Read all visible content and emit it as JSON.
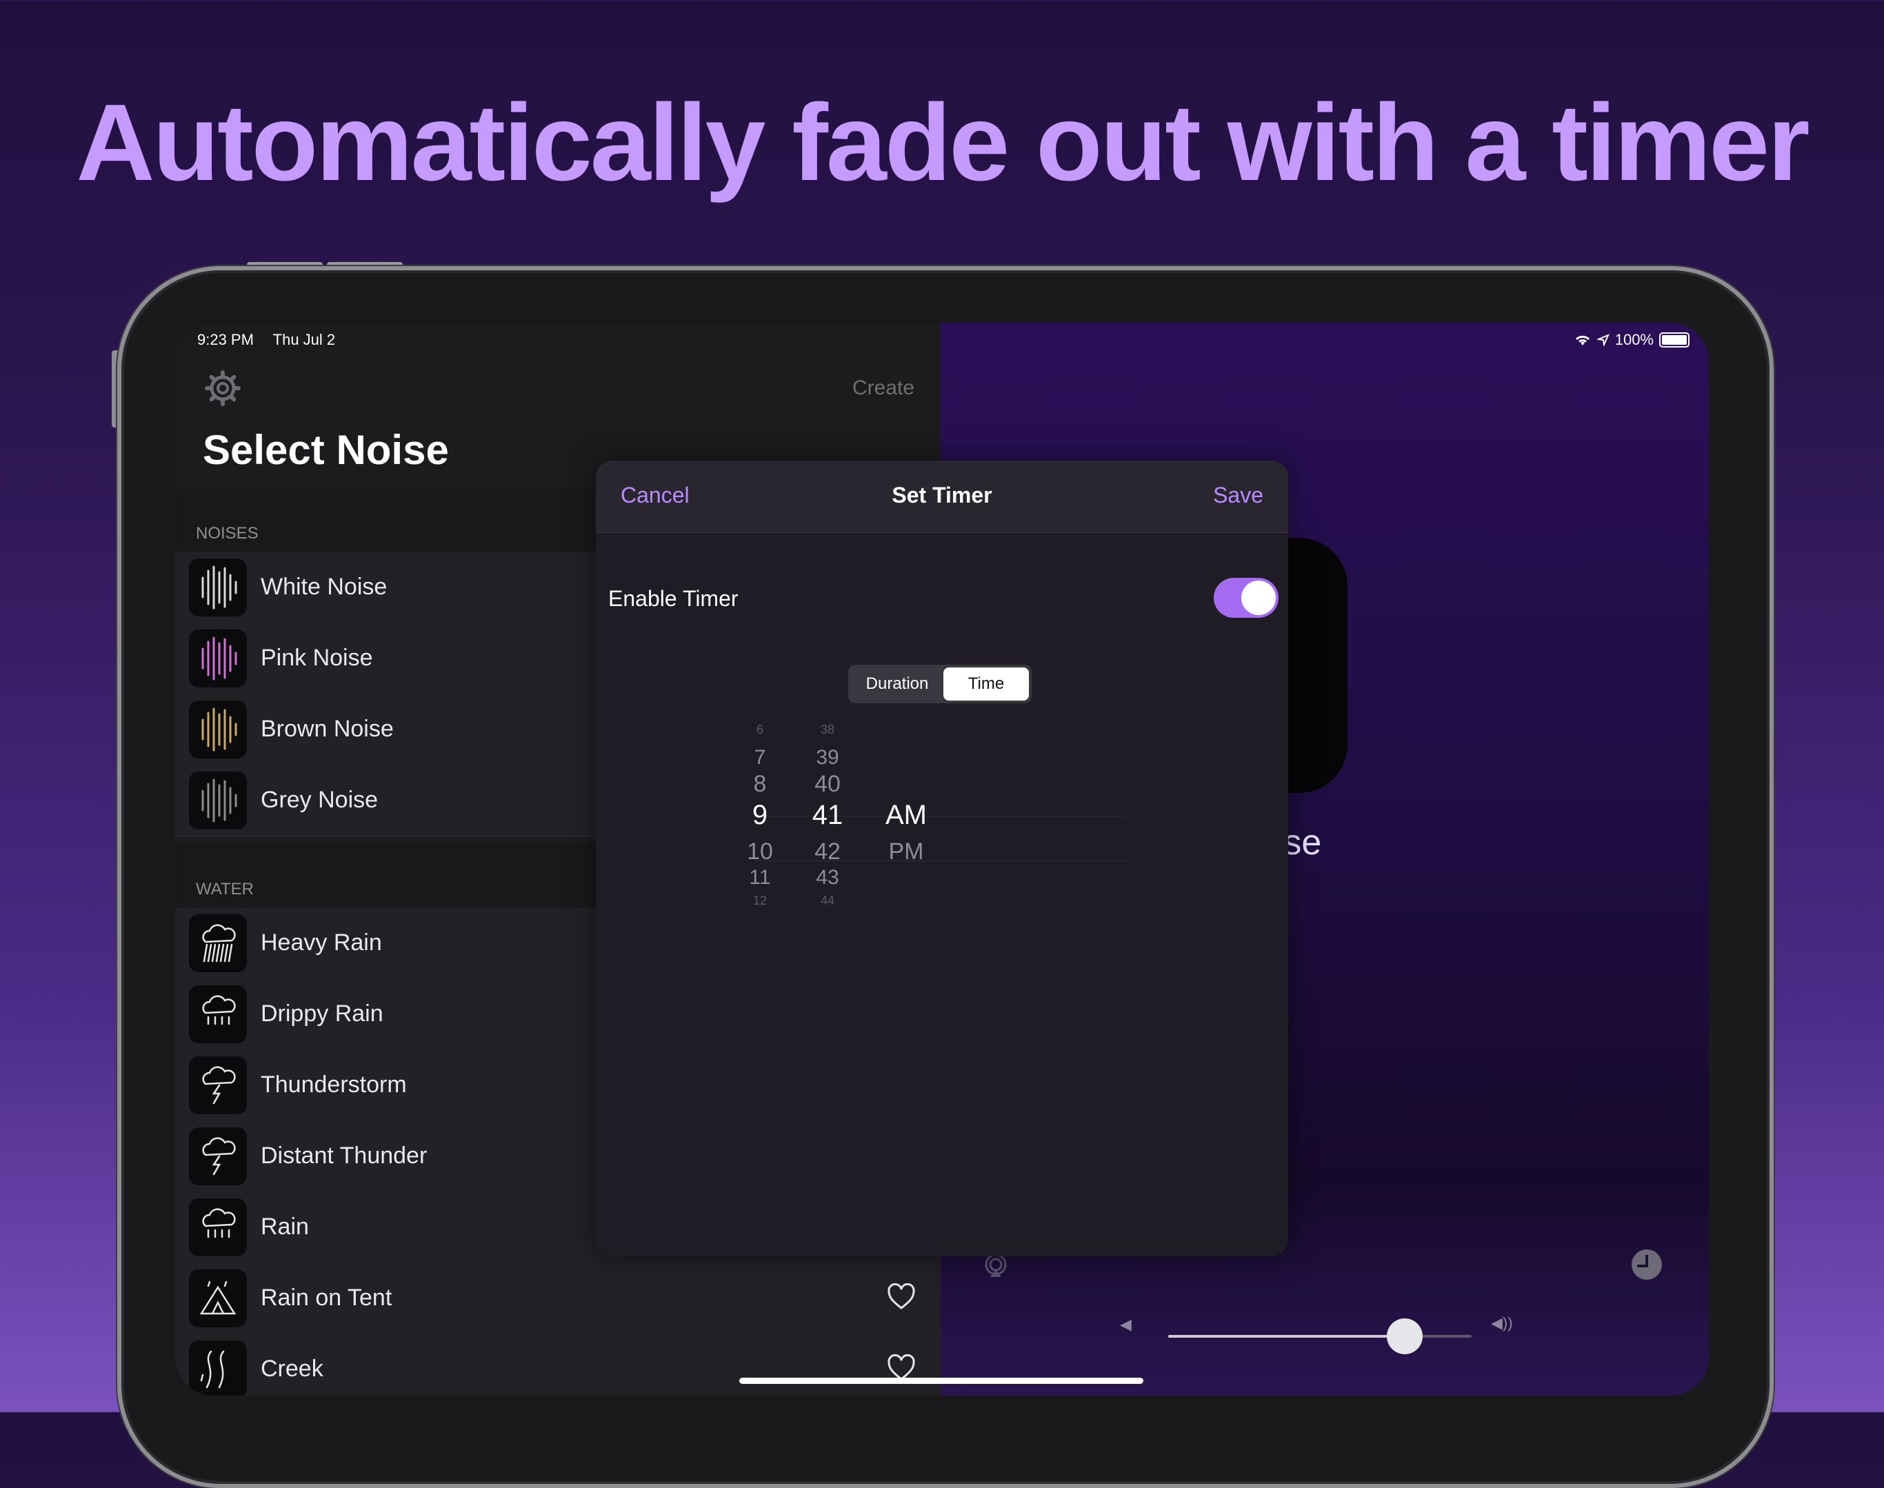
{
  "headline": "Automatically fade out with a timer",
  "status": {
    "time": "9:23 PM",
    "date": "Thu Jul 2",
    "battery": "100%"
  },
  "master": {
    "create_label": "Create",
    "title": "Select Noise",
    "sections": [
      {
        "header": "NOISES",
        "items": [
          {
            "label": "White Noise",
            "icon": "waveform-icon",
            "color": "#d8d8d8"
          },
          {
            "label": "Pink Noise",
            "icon": "waveform-icon",
            "color": "#d16fd6"
          },
          {
            "label": "Brown Noise",
            "icon": "waveform-icon",
            "color": "#c9a86a"
          },
          {
            "label": "Grey Noise",
            "icon": "waveform-icon",
            "color": "#8c8c8c"
          }
        ]
      },
      {
        "header": "WATER",
        "items": [
          {
            "label": "Heavy Rain",
            "icon": "heavy-rain-icon"
          },
          {
            "label": "Drippy Rain",
            "icon": "drippy-rain-icon"
          },
          {
            "label": "Thunderstorm",
            "icon": "thunderstorm-icon"
          },
          {
            "label": "Distant Thunder",
            "icon": "distant-thunder-icon"
          },
          {
            "label": "Rain",
            "icon": "rain-icon"
          },
          {
            "label": "Rain on Tent",
            "icon": "tent-rain-icon"
          },
          {
            "label": "Creek",
            "icon": "creek-icon"
          }
        ]
      }
    ]
  },
  "modal": {
    "cancel_label": "Cancel",
    "title": "Set Timer",
    "save_label": "Save",
    "enable_label": "Enable Timer",
    "enabled": true,
    "segments": [
      "Duration",
      "Time"
    ],
    "selected_segment": "Time",
    "hours": [
      "6",
      "7",
      "8",
      "9",
      "10",
      "11",
      "12"
    ],
    "minutes": [
      "38",
      "39",
      "40",
      "41",
      "42",
      "43",
      "44"
    ],
    "ampm": [
      "AM",
      "PM"
    ],
    "selected": {
      "hour": "9",
      "minute": "41",
      "ampm": "AM"
    }
  },
  "now_playing": {
    "title": "ite Noise",
    "volume_percent": 78
  },
  "colors": {
    "accent": "#b98bff",
    "headline": "#c59bff",
    "toggle": "#a56cf2"
  }
}
